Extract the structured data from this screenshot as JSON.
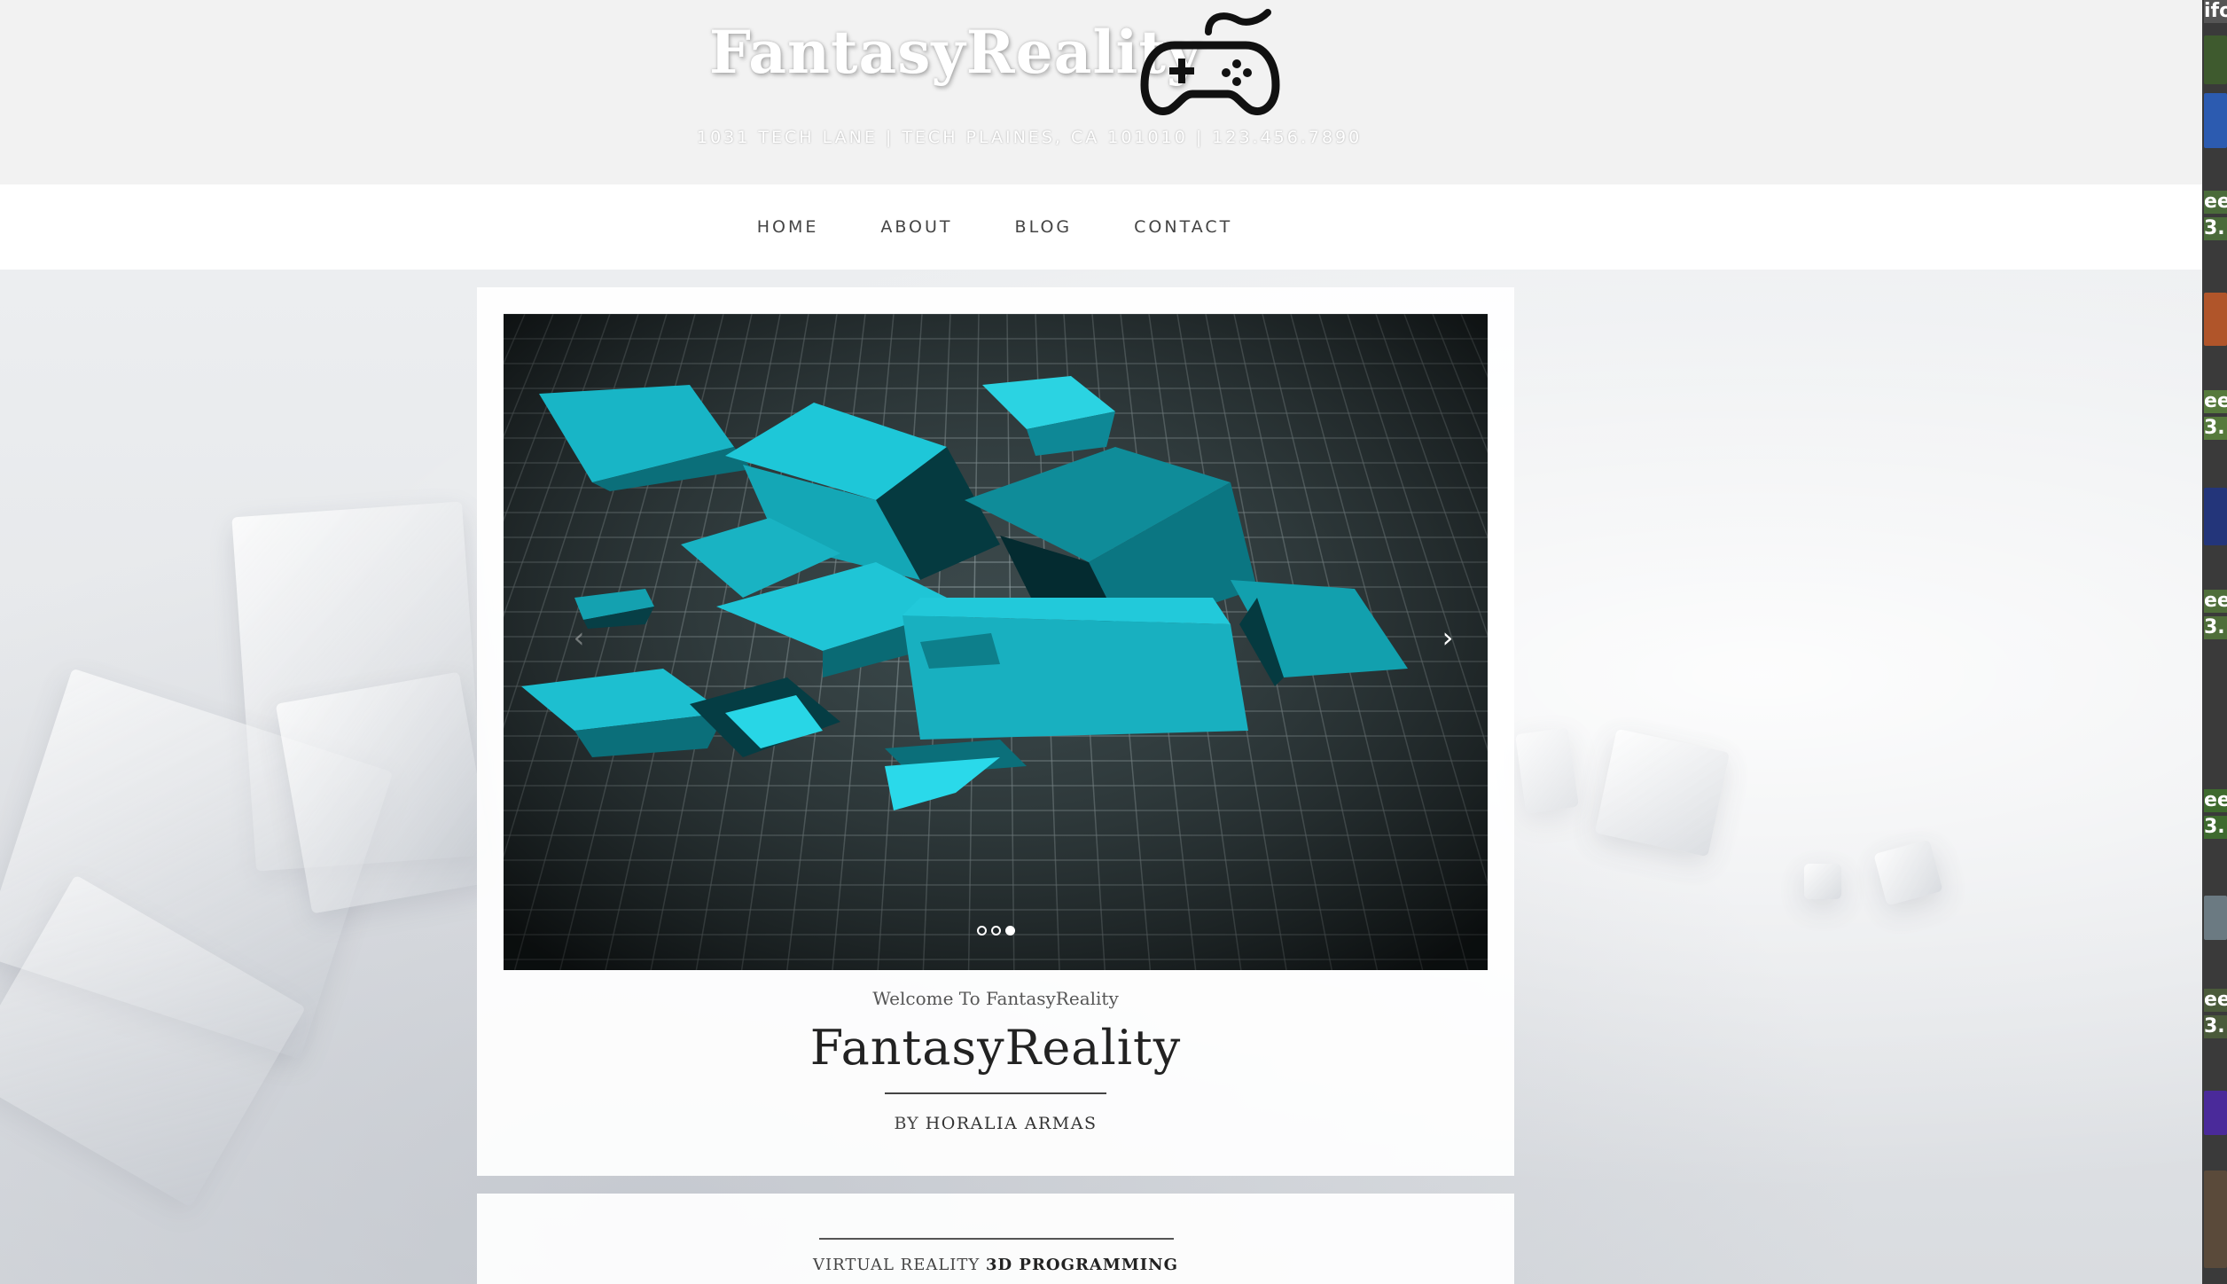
{
  "site": {
    "title": "FantasyReality",
    "address": "1031 TECH LANE | TECH PLAINES, CA 101010 | 123.456.7890"
  },
  "nav": {
    "items": [
      {
        "label": "HOME"
      },
      {
        "label": "ABOUT"
      },
      {
        "label": "BLOG"
      },
      {
        "label": "CONTACT"
      }
    ]
  },
  "slider": {
    "prev_symbol": "‹",
    "next_symbol": "›",
    "slide_count": 3,
    "active_slide": 3
  },
  "post": {
    "welcome": "Welcome To FantasyReality",
    "title": "FantasyReality",
    "by_label": "BY",
    "author": "HORALIA ARMAS"
  },
  "post2": {
    "category_prefix": "VIRTUAL REALITY",
    "category_strong": "3D PROGRAMMING"
  },
  "right_strip": {
    "labels": [
      "ifo",
      "eer",
      "3.",
      "eer",
      "3.",
      "eer",
      "3.",
      "eer",
      "3.",
      "eer",
      "3."
    ]
  },
  "colors": {
    "accent_cube": "#19b9c9",
    "grid_bg": "#152124",
    "header_bg": "#f2f2f2"
  }
}
